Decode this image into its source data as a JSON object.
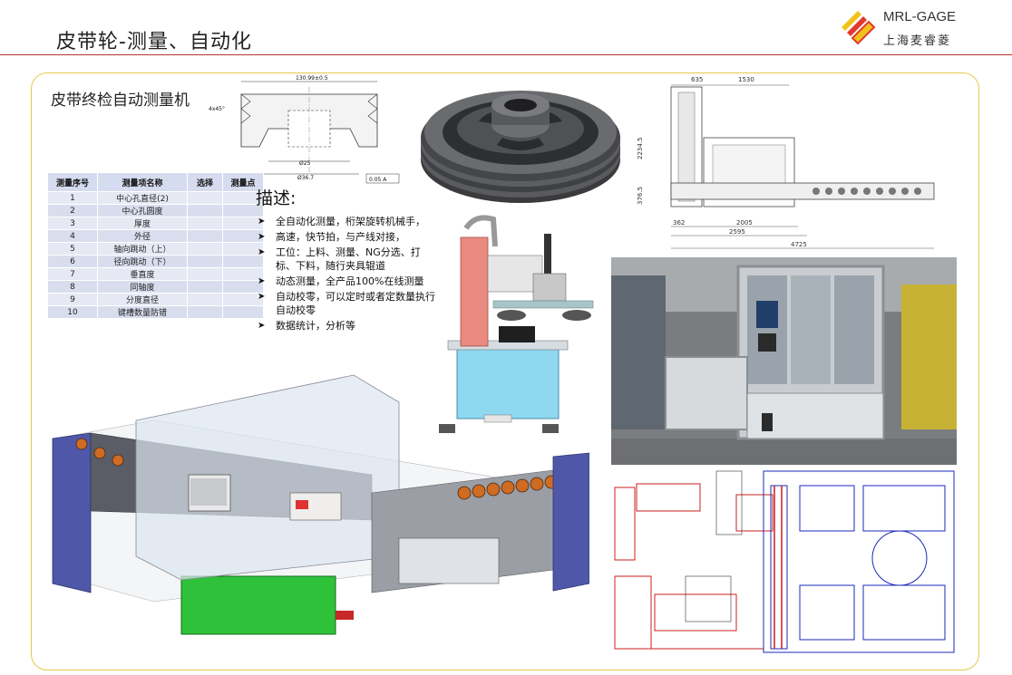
{
  "header": {
    "title": "皮带轮-测量、自动化",
    "logo_text_en": "MRL-GAGE",
    "logo_text_cn": "上海麦睿菱"
  },
  "section_title": "皮带终检自动测量机",
  "drawing": {
    "dim_top": "130.99±0.5",
    "dim_left": "4x45°",
    "dim_bottom1": "Ø25",
    "dim_bottom2": "Ø36.7",
    "dim_right": "0.05 A"
  },
  "table": {
    "headers": [
      "测量序号",
      "测量项名称",
      "选择",
      "测量点"
    ],
    "rows": [
      [
        "1",
        "中心孔直径(2)",
        "",
        ""
      ],
      [
        "2",
        "中心孔圆度",
        "",
        ""
      ],
      [
        "3",
        "厚度",
        "",
        ""
      ],
      [
        "4",
        "外径",
        "",
        ""
      ],
      [
        "5",
        "轴向跳动（上）",
        "",
        ""
      ],
      [
        "6",
        "径向跳动（下）",
        "",
        ""
      ],
      [
        "7",
        "垂直度",
        "",
        ""
      ],
      [
        "8",
        "同轴度",
        "",
        ""
      ],
      [
        "9",
        "分度直径",
        "",
        ""
      ],
      [
        "10",
        "键槽数量防错",
        "",
        ""
      ]
    ]
  },
  "description": {
    "title": "描述:",
    "items": [
      "全自动化测量，桁架旋转机械手，",
      "高速，快节拍，与产线对接，",
      "工位：上料、测量、NG分选、打标、下料，随行夹具辊道",
      "动态测量，全产品100%在线测量",
      "自动校零，可以定时或者定数量执行自动校零",
      "数据统计，分析等"
    ]
  },
  "layout_drawing": {
    "dims": [
      "635",
      "1530",
      "2234.5",
      "376.5",
      "362",
      "2005",
      "2595",
      "4725"
    ]
  },
  "icons": {
    "bullet": "arrow-bullet-icon",
    "logo": "mrl-gage-logo-icon"
  },
  "colors": {
    "accent_line": "#b33333",
    "frame": "#e8c84a",
    "table_header": "#d6dcef"
  }
}
